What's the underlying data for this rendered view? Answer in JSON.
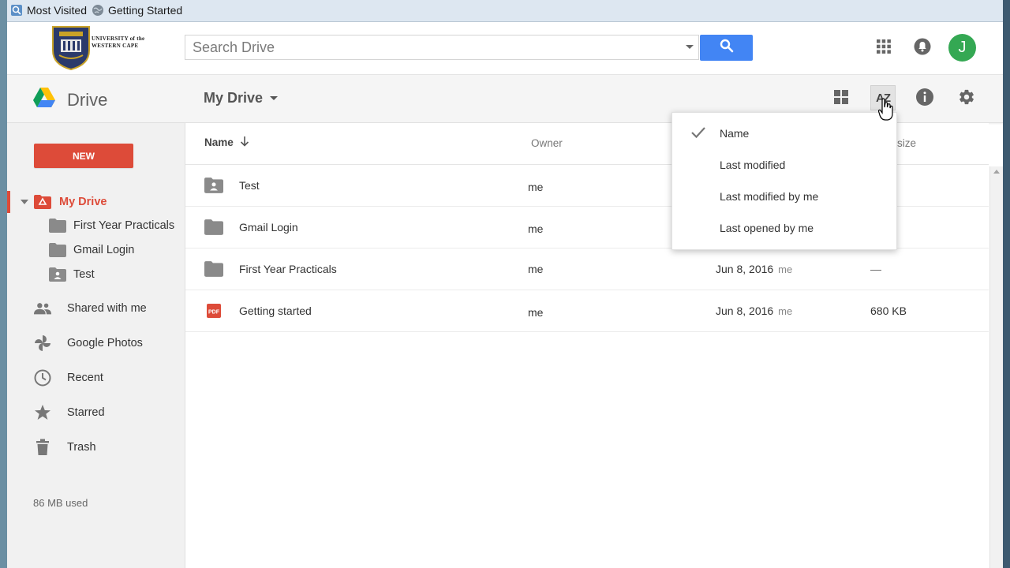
{
  "bookmarks": [
    {
      "label": "Most Visited",
      "icon": "most-visited-icon"
    },
    {
      "label": "Getting Started",
      "icon": "globe-icon"
    }
  ],
  "header": {
    "logo_text_line1": "UNIVERSITY of the",
    "logo_text_line2": "WESTERN CAPE",
    "search_placeholder": "Search Drive",
    "avatar_letter": "J",
    "accent": "#4285f4"
  },
  "subbar": {
    "brand": "Drive",
    "location": "My Drive"
  },
  "sidebar": {
    "new_label": "NEW",
    "my_drive": "My Drive",
    "subfolders": [
      "First Year Practicals",
      "Gmail Login",
      "Test"
    ],
    "items": [
      {
        "label": "Shared with me",
        "icon": "people-icon"
      },
      {
        "label": "Google Photos",
        "icon": "photos-pinwheel-icon"
      },
      {
        "label": "Recent",
        "icon": "clock-icon"
      },
      {
        "label": "Starred",
        "icon": "star-icon"
      },
      {
        "label": "Trash",
        "icon": "trash-icon"
      }
    ],
    "storage_used": "86 MB used",
    "active_color": "#dd4b39"
  },
  "table": {
    "columns": {
      "name": "Name",
      "owner": "Owner",
      "size": "size"
    },
    "rows": [
      {
        "name": "Test",
        "type": "shared-folder",
        "owner": "me",
        "modified": "",
        "modified_by": "",
        "size": ""
      },
      {
        "name": "Gmail Login",
        "type": "folder",
        "owner": "me",
        "modified": "",
        "modified_by": "",
        "size": ""
      },
      {
        "name": "First Year Practicals",
        "type": "folder",
        "owner": "me",
        "modified": "Jun 8, 2016",
        "modified_by": "me",
        "size": "—"
      },
      {
        "name": "Getting started",
        "type": "pdf",
        "owner": "me",
        "modified": "Jun 8, 2016",
        "modified_by": "me",
        "size": "680 KB"
      }
    ]
  },
  "sort_menu": {
    "items": [
      "Name",
      "Last modified",
      "Last modified by me",
      "Last opened by me"
    ],
    "selected": "Name"
  },
  "toolbar": {
    "sort_label": "AZ"
  }
}
